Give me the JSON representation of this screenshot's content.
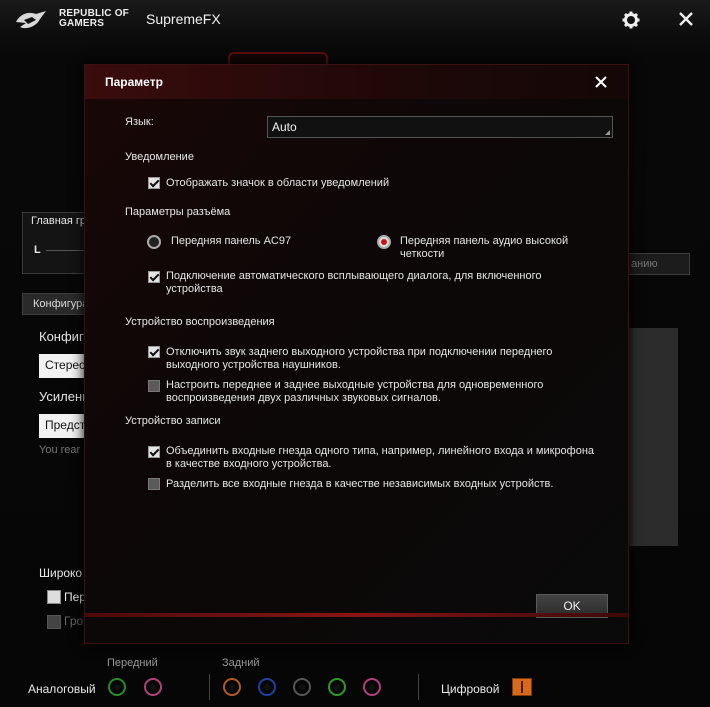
{
  "app": {
    "brand_line1": "REPUBLIC OF",
    "brand_line2": "GAMERS",
    "title": "SupremeFX"
  },
  "background": {
    "main_volume_label": "Главная гр",
    "channel_l": "L",
    "config_tab": "Конфигура",
    "config_label": "Конфигу",
    "config_value": "Стерео",
    "amp_label": "Усилени",
    "amp_value": "Предст",
    "hint_text": "You rear l",
    "right_tab_text": "анию",
    "wide_label": "Широко",
    "front_cb_label": "Пер",
    "gray_cb_label": "Гро"
  },
  "bottom": {
    "analog_label": "Аналоговый",
    "front_label": "Передний",
    "rear_label": "Задний",
    "digital_label": "Цифровой"
  },
  "dialog": {
    "title": "Параметр",
    "language_label": "Язык:",
    "language_value": "Auto",
    "notifications_header": "Уведомление",
    "show_tray_icon": "Отображать значок в области уведомлений",
    "connector_header": "Параметры разъёма",
    "radio_ac97": "Передняя панель AC97",
    "radio_hd_line1": "Передняя панель аудио высокой",
    "radio_hd_line2": "четкости",
    "auto_popup_line1": "Подключение автоматического всплывающего диалога, для включенного",
    "auto_popup_line2": "устройства",
    "playback_header": "Устройство воспроизведения",
    "mute_rear_line1": "Отключить звук заднего выходного устройства при подключении переднего",
    "mute_rear_line2": "выходного устройства наушников.",
    "multistream_line1": "Настроить переднее и заднее выходные устройства для одновременного",
    "multistream_line2": "воспроизведения двух различных звуковых сигналов.",
    "record_header": "Устройство записи",
    "combine_inputs_line1": "Объединить входные гнезда одного типа, например, линейного входа и микрофона",
    "combine_inputs_line2": "в качестве входного устройства.",
    "separate_inputs": "Разделить все входные гнезда в качестве независимых входных устройств.",
    "ok_label": "OK"
  },
  "state": {
    "show_tray_icon": true,
    "radio_selected": "hd",
    "auto_popup": true,
    "mute_rear": true,
    "multistream": false,
    "combine_inputs": true,
    "separate_inputs": false
  },
  "colors": {
    "accent_red": "#c41515",
    "jack_green": "#2a8a2a",
    "jack_pink": "#b0407a",
    "jack_orange": "#b05a20",
    "jack_blue": "#2040a0",
    "jack_black": "#303030",
    "digital_orange": "#d86a1a"
  },
  "icons": [
    "rog-logo-icon",
    "gear-icon",
    "close-icon",
    "dropdown-arrow-icon"
  ]
}
